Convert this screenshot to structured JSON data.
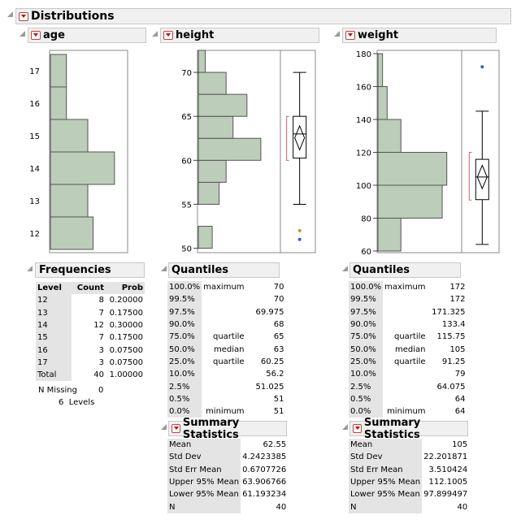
{
  "title": "Distributions",
  "colors": {
    "bar_fill": "#bccdb9",
    "bar_stroke": "#555",
    "ci_bracket": "#d06070",
    "outlier_orange": "#e08830",
    "outlier_blue": "#3a5fc0"
  },
  "panels": {
    "age": {
      "title": "age"
    },
    "height": {
      "title": "height"
    },
    "weight": {
      "title": "weight"
    }
  },
  "frequencies": {
    "title": "Frequencies",
    "headers": [
      "Level",
      "Count",
      "Prob"
    ],
    "rows": [
      [
        "12",
        "8",
        "0.20000"
      ],
      [
        "13",
        "7",
        "0.17500"
      ],
      [
        "14",
        "12",
        "0.30000"
      ],
      [
        "15",
        "7",
        "0.17500"
      ],
      [
        "16",
        "3",
        "0.07500"
      ],
      [
        "17",
        "3",
        "0.07500"
      ],
      [
        "Total",
        "40",
        "1.00000"
      ]
    ],
    "n_missing_label": "N Missing",
    "n_missing_value": "0",
    "levels_text": "6  Levels"
  },
  "height_quantiles": {
    "title": "Quantiles",
    "rows": [
      [
        "100.0%",
        "maximum",
        "70"
      ],
      [
        "99.5%",
        "",
        "70"
      ],
      [
        "97.5%",
        "",
        "69.975"
      ],
      [
        "90.0%",
        "",
        "68"
      ],
      [
        "75.0%",
        "quartile",
        "65"
      ],
      [
        "50.0%",
        "median",
        "63"
      ],
      [
        "25.0%",
        "quartile",
        "60.25"
      ],
      [
        "10.0%",
        "",
        "56.2"
      ],
      [
        "2.5%",
        "",
        "51.025"
      ],
      [
        "0.5%",
        "",
        "51"
      ],
      [
        "0.0%",
        "minimum",
        "51"
      ]
    ]
  },
  "height_summary": {
    "title": "Summary Statistics",
    "rows": [
      [
        "Mean",
        "62.55"
      ],
      [
        "Std Dev",
        "4.2423385"
      ],
      [
        "Std Err Mean",
        "0.6707726"
      ],
      [
        "Upper 95% Mean",
        "63.906766"
      ],
      [
        "Lower 95% Mean",
        "61.193234"
      ],
      [
        "N",
        "40"
      ]
    ]
  },
  "weight_quantiles": {
    "title": "Quantiles",
    "rows": [
      [
        "100.0%",
        "maximum",
        "172"
      ],
      [
        "99.5%",
        "",
        "172"
      ],
      [
        "97.5%",
        "",
        "171.325"
      ],
      [
        "90.0%",
        "",
        "133.4"
      ],
      [
        "75.0%",
        "quartile",
        "115.75"
      ],
      [
        "50.0%",
        "median",
        "105"
      ],
      [
        "25.0%",
        "quartile",
        "91.25"
      ],
      [
        "10.0%",
        "",
        "79"
      ],
      [
        "2.5%",
        "",
        "64.075"
      ],
      [
        "0.5%",
        "",
        "64"
      ],
      [
        "0.0%",
        "minimum",
        "64"
      ]
    ]
  },
  "weight_summary": {
    "title": "Summary Statistics",
    "rows": [
      [
        "Mean",
        "105"
      ],
      [
        "Std Dev",
        "22.201871"
      ],
      [
        "Std Err Mean",
        "3.510424"
      ],
      [
        "Upper 95% Mean",
        "112.1005"
      ],
      [
        "Lower 95% Mean",
        "97.899497"
      ],
      [
        "N",
        "40"
      ]
    ]
  },
  "chart_data": [
    {
      "type": "bar",
      "orientation": "horizontal",
      "title": "age",
      "categories": [
        "12",
        "13",
        "14",
        "15",
        "16",
        "17"
      ],
      "values": [
        8,
        7,
        12,
        7,
        3,
        3
      ],
      "max_count": 14
    },
    {
      "type": "bar",
      "orientation": "horizontal",
      "title": "height",
      "bins": [
        [
          50,
          52.5
        ],
        [
          52.5,
          55
        ],
        [
          55,
          57.5
        ],
        [
          57.5,
          60
        ],
        [
          60,
          62.5
        ],
        [
          62.5,
          65
        ],
        [
          65,
          67.5
        ],
        [
          67.5,
          70
        ],
        [
          70,
          72.5
        ]
      ],
      "values": [
        2,
        0,
        3,
        4,
        9,
        5,
        7,
        4,
        1
      ],
      "max_count": 11,
      "yticks": [
        50,
        55,
        60,
        65,
        70
      ],
      "ylim": [
        49.5,
        72.5
      ],
      "boxplot": {
        "min": 55,
        "q1": 60.25,
        "median": 63,
        "q3": 65,
        "max": 70,
        "mean": 62.55,
        "ci": [
          61.193234,
          63.906766
        ],
        "shortest_half": [
          60,
          65
        ],
        "outliers": [
          {
            "value": 52,
            "color": "orange"
          },
          {
            "value": 51,
            "color": "blue"
          }
        ]
      }
    },
    {
      "type": "bar",
      "orientation": "horizontal",
      "title": "weight",
      "bins": [
        [
          60,
          80
        ],
        [
          80,
          100
        ],
        [
          100,
          120
        ],
        [
          120,
          140
        ],
        [
          140,
          160
        ],
        [
          160,
          180
        ]
      ],
      "values": [
        5,
        14,
        15,
        5,
        2,
        1
      ],
      "max_count": 17,
      "yticks": [
        60,
        80,
        100,
        120,
        140,
        160,
        180
      ],
      "ylim": [
        59,
        182
      ],
      "boxplot": {
        "min": 64,
        "q1": 91.25,
        "median": 105,
        "q3": 115.75,
        "max": 145,
        "mean": 105,
        "ci": [
          97.899497,
          112.1005
        ],
        "shortest_half": [
          91,
          120
        ],
        "outliers": [
          {
            "value": 172,
            "color": "blue"
          }
        ]
      }
    }
  ]
}
